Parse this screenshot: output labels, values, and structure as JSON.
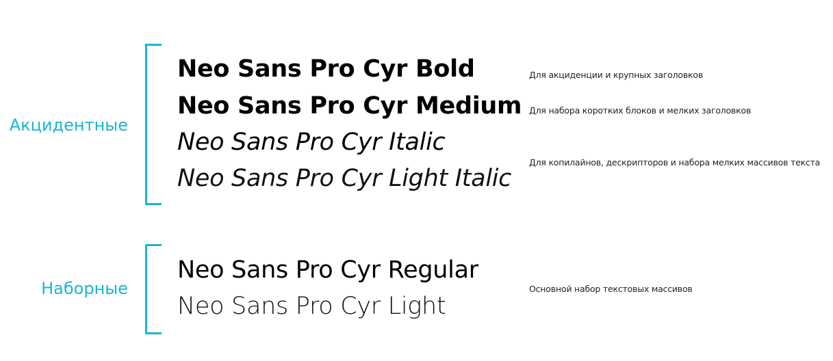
{
  "colors": {
    "accent": "#1ab5d3",
    "text": "#000000"
  },
  "groups": [
    {
      "label": "Акцидентные",
      "fonts": [
        {
          "name": "Neo Sans Pro Cyr Bold",
          "description": "Для акциденции и крупных заголовков"
        },
        {
          "name": "Neo Sans Pro Cyr Medium",
          "description": "Для набора коротких блоков и мелких заголовков"
        },
        {
          "name": "Neo Sans Pro Cyr Italic",
          "description": "Для копилайнов, дескрипторов и набора мелких массивов текста"
        },
        {
          "name": "Neo Sans Pro Cyr Light Italic"
        }
      ]
    },
    {
      "label": "Наборные",
      "fonts": [
        {
          "name": "Neo Sans Pro Cyr Regular",
          "description": "Основной набор текстовых массивов"
        },
        {
          "name": "Neo Sans Pro Cyr Light"
        }
      ]
    }
  ]
}
